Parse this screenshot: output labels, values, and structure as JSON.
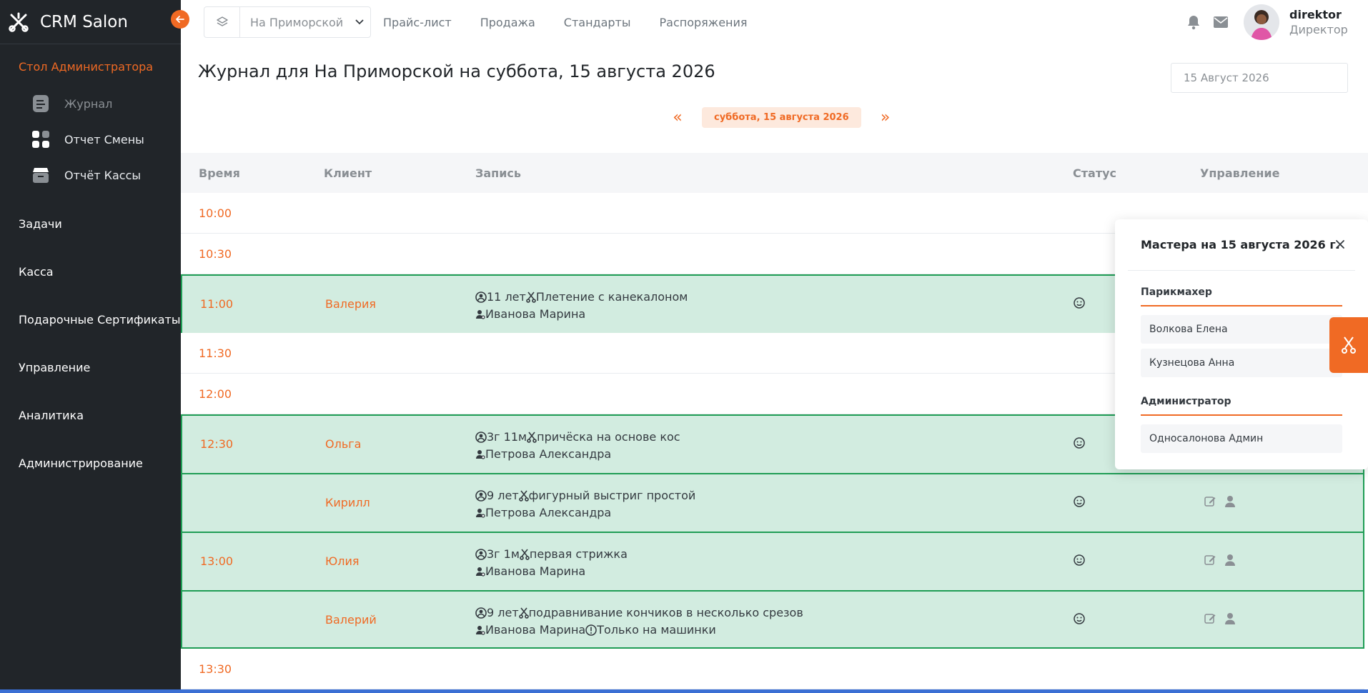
{
  "app": {
    "name": "CRM Salon"
  },
  "sidebar": {
    "section_title": "Стол Администратора",
    "sub_items": [
      {
        "label": "Журнал",
        "icon": "document-icon",
        "active": true
      },
      {
        "label": "Отчет Смены",
        "icon": "grid-icon",
        "active": false
      },
      {
        "label": "Отчёт Кассы",
        "icon": "cashbox-icon",
        "active": false
      }
    ],
    "items": [
      {
        "label": "Задачи"
      },
      {
        "label": "Касса"
      },
      {
        "label": "Подарочные Сертификаты"
      },
      {
        "label": "Управление"
      },
      {
        "label": "Аналитика"
      },
      {
        "label": "Администрирование"
      }
    ]
  },
  "topbar": {
    "branch": "На Приморской",
    "nav": [
      "Прайс-лист",
      "Продажа",
      "Стандарты",
      "Распоряжения"
    ],
    "user": {
      "name": "direktor",
      "role": "Директор"
    }
  },
  "page": {
    "title": "Журнал для На Приморской на суббота, 15 августа 2026",
    "date_input": "15 Август 2026",
    "date_pill": "суббота, 15 августа 2026",
    "prev": "«",
    "next": "»"
  },
  "table": {
    "headers": {
      "time": "Время",
      "client": "Клиент",
      "record": "Запись",
      "status": "Статус",
      "actions": "Управление"
    },
    "rows": [
      {
        "type": "empty",
        "time": "10:00"
      },
      {
        "type": "empty",
        "time": "10:30"
      },
      {
        "type": "booked",
        "time": "11:00",
        "client": "Валерия",
        "age": "11 лет",
        "service": "Плетение с канекалоном",
        "master": "Иванова Марина",
        "note": ""
      },
      {
        "type": "empty",
        "time": "11:30"
      },
      {
        "type": "empty",
        "time": "12:00"
      },
      {
        "type": "booked",
        "time": "12:30",
        "client": "Ольга",
        "age": "3г 11м",
        "service": "причёска на основе кос",
        "master": "Петрова Александра",
        "note": ""
      },
      {
        "type": "booked",
        "time": "",
        "client": "Кирилл",
        "age": "9 лет",
        "service": "фигурный выстриг простой",
        "master": "Петрова Александра",
        "note": ""
      },
      {
        "type": "booked",
        "time": "13:00",
        "client": "Юлия",
        "age": "3г 1м",
        "service": "первая стрижка",
        "master": "Иванова Марина",
        "note": ""
      },
      {
        "type": "booked",
        "time": "",
        "client": "Валерий",
        "age": "9 лет",
        "service": "подравнивание кончиков в несколько срезов",
        "master": "Иванова Марина",
        "note": "Только на машинки"
      },
      {
        "type": "empty",
        "time": "13:30"
      }
    ]
  },
  "masters_panel": {
    "title": "Мастера на 15 августа 2026 г.",
    "groups": [
      {
        "title": "Парикмахер",
        "members": [
          "Волкова Елена",
          "Кузнецова Анна"
        ]
      },
      {
        "title": "Администратор",
        "members": [
          "Односалонова Админ"
        ]
      }
    ]
  },
  "colors": {
    "accent": "#f06a24",
    "sidebar": "#212529",
    "booked_bg": "#d2ece0",
    "booked_border": "#1f9d55"
  }
}
